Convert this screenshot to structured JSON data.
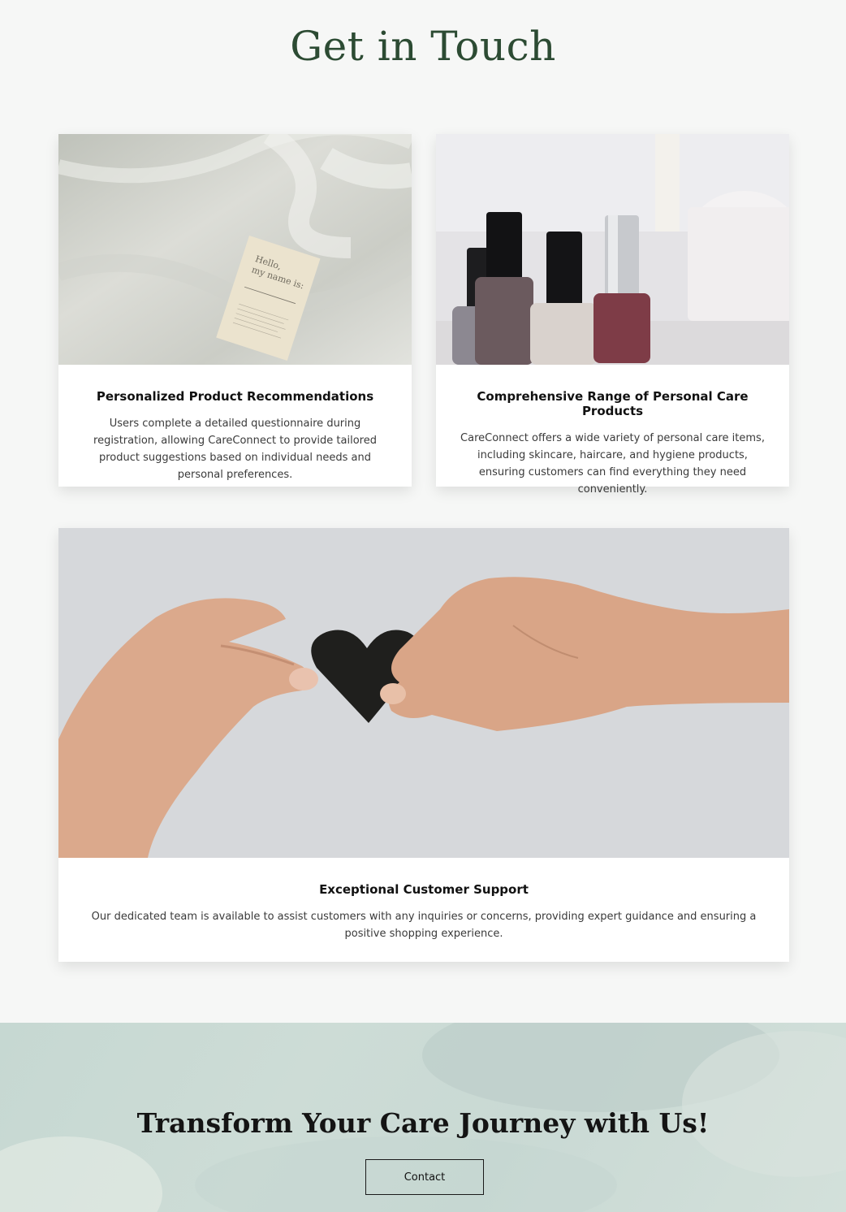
{
  "section": {
    "title": "Get in Touch"
  },
  "cards": [
    {
      "image_alt": "name card on bedsheet",
      "title": "Personalized Product Recommendations",
      "text": "Users complete a detailed questionnaire during registration, allowing CareConnect to provide tailored product suggestions based on individual needs and personal preferences."
    },
    {
      "image_alt": "nail polish bottles",
      "title": "Comprehensive Range of Personal Care Products",
      "text": "CareConnect offers a wide variety of personal care items, including skincare, haircare, and hygiene products, ensuring customers can find everything they need conveniently."
    },
    {
      "image_alt": "hands holding paper heart",
      "title": "Exceptional Customer Support",
      "text": "Our dedicated team is available to assist customers with any inquiries or concerns, providing expert guidance and ensuring a positive shopping experience."
    }
  ],
  "cta": {
    "title": "Transform Your Care Journey with Us!",
    "button_label": "Contact"
  },
  "colors": {
    "heading_green": "#2c4b33",
    "cta_background": "#c9d9d4",
    "page_background": "#f6f7f6"
  }
}
